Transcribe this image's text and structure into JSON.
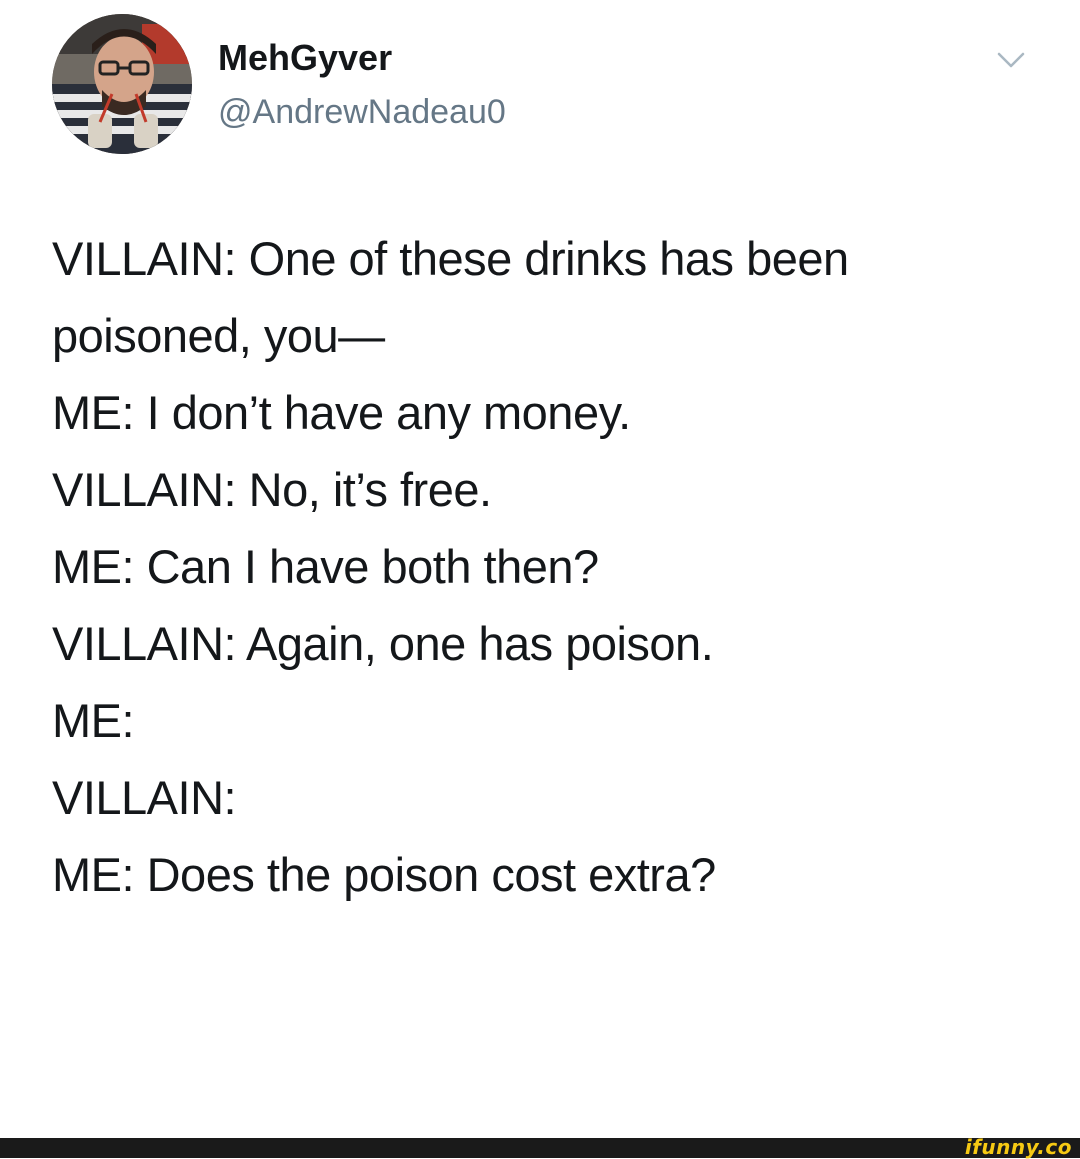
{
  "author": {
    "display_name": "MehGyver",
    "handle": "@AndrewNadeau0",
    "avatar_icon": "user-avatar-photo"
  },
  "menu": {
    "icon": "chevron-down-icon"
  },
  "tweet": {
    "lines": [
      "VILLAIN: One of these drinks has been",
      "poisoned, you—",
      "ME: I don’t have any money.",
      "VILLAIN: No, it’s free.",
      "ME: Can I have both then?",
      "VILLAIN: Again, one has poison.",
      "ME:",
      "VILLAIN:",
      "ME: Does the poison cost extra?"
    ]
  },
  "watermark": {
    "text": "ifunny.co"
  },
  "colors": {
    "text": "#14171a",
    "secondary": "#657786",
    "watermark": "#f6c913",
    "footer": "#1a1a1a"
  }
}
